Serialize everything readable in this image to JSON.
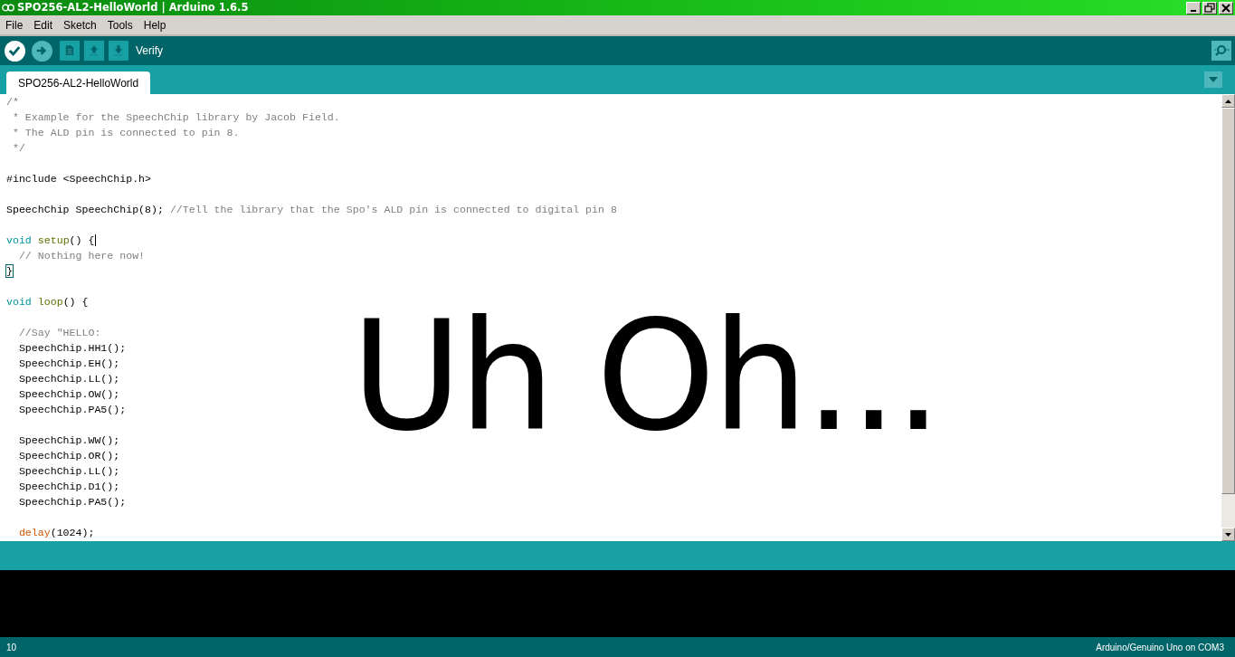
{
  "window": {
    "title": "SPO256-AL2-HelloWorld | Arduino 1.6.5"
  },
  "menu": [
    "File",
    "Edit",
    "Sketch",
    "Tools",
    "Help"
  ],
  "toolbar": {
    "buttons": [
      {
        "kind": "verify",
        "selected": true
      },
      {
        "kind": "upload",
        "selected": false
      },
      {
        "kind": "new",
        "selected": false
      },
      {
        "kind": "open",
        "selected": false
      },
      {
        "kind": "save",
        "selected": false
      }
    ],
    "hint": "Verify"
  },
  "tabs": [
    {
      "label": "SPO256-AL2-HelloWorld",
      "selected": true
    }
  ],
  "editor": {
    "lines": [
      {
        "kind": "code",
        "segments": [
          {
            "kind": "comment",
            "text": "/*"
          }
        ]
      },
      {
        "kind": "code",
        "segments": [
          {
            "kind": "comment",
            "text": " * Example for the SpeechChip library by Jacob Field."
          }
        ]
      },
      {
        "kind": "code",
        "segments": [
          {
            "kind": "comment",
            "text": " * The ALD pin is connected to pin 8."
          }
        ]
      },
      {
        "kind": "code",
        "segments": [
          {
            "kind": "comment",
            "text": " */"
          }
        ]
      },
      {
        "kind": "blank"
      },
      {
        "kind": "code",
        "segments": [
          {
            "kind": "plain",
            "text": "#include <SpeechChip.h>"
          }
        ]
      },
      {
        "kind": "blank"
      },
      {
        "kind": "code",
        "segments": [
          {
            "kind": "plain",
            "text": "SpeechChip SpeechChip(8); "
          },
          {
            "kind": "comment",
            "text": "//Tell the library that the Spo's ALD pin is connected to digital pin 8"
          }
        ]
      },
      {
        "kind": "blank"
      },
      {
        "kind": "code",
        "segments": [
          {
            "kind": "keyword",
            "text": "void"
          },
          {
            "kind": "function",
            "text": " setup"
          },
          {
            "kind": "plain",
            "text": "() {"
          },
          {
            "kind": "caret"
          }
        ]
      },
      {
        "kind": "code",
        "segments": [
          {
            "kind": "comment",
            "text": "  // Nothing here now!"
          }
        ]
      },
      {
        "kind": "code",
        "segments": [
          {
            "kind": "bracket_match",
            "text": "}"
          }
        ]
      },
      {
        "kind": "blank"
      },
      {
        "kind": "code",
        "segments": [
          {
            "kind": "keyword",
            "text": "void"
          },
          {
            "kind": "function",
            "text": " loop"
          },
          {
            "kind": "plain",
            "text": "() {"
          }
        ]
      },
      {
        "kind": "blank"
      },
      {
        "kind": "code",
        "segments": [
          {
            "kind": "comment",
            "text": "  //Say \"HELLO:"
          }
        ]
      },
      {
        "kind": "code",
        "segments": [
          {
            "kind": "plain",
            "text": "  SpeechChip.HH1();"
          }
        ]
      },
      {
        "kind": "code",
        "segments": [
          {
            "kind": "plain",
            "text": "  SpeechChip.EH();"
          }
        ]
      },
      {
        "kind": "code",
        "segments": [
          {
            "kind": "plain",
            "text": "  SpeechChip.LL();"
          }
        ]
      },
      {
        "kind": "code",
        "segments": [
          {
            "kind": "plain",
            "text": "  SpeechChip.OW();"
          }
        ]
      },
      {
        "kind": "code",
        "segments": [
          {
            "kind": "plain",
            "text": "  SpeechChip.PA5();"
          }
        ]
      },
      {
        "kind": "blank"
      },
      {
        "kind": "code",
        "segments": [
          {
            "kind": "plain",
            "text": "  SpeechChip.WW();"
          }
        ]
      },
      {
        "kind": "code",
        "segments": [
          {
            "kind": "plain",
            "text": "  SpeechChip.OR();"
          }
        ]
      },
      {
        "kind": "code",
        "segments": [
          {
            "kind": "plain",
            "text": "  SpeechChip.LL();"
          }
        ]
      },
      {
        "kind": "code",
        "segments": [
          {
            "kind": "plain",
            "text": "  SpeechChip.D1();"
          }
        ]
      },
      {
        "kind": "code",
        "segments": [
          {
            "kind": "plain",
            "text": "  SpeechChip.PA5();"
          }
        ]
      },
      {
        "kind": "blank"
      },
      {
        "kind": "code",
        "segments": [
          {
            "kind": "builtin",
            "text": "  delay"
          },
          {
            "kind": "plain",
            "text": "(1024);"
          }
        ]
      }
    ]
  },
  "overlay": {
    "text": "Uh Oh..."
  },
  "status_bar": {
    "line": "10",
    "board": "Arduino/Genuino Uno on COM3"
  }
}
